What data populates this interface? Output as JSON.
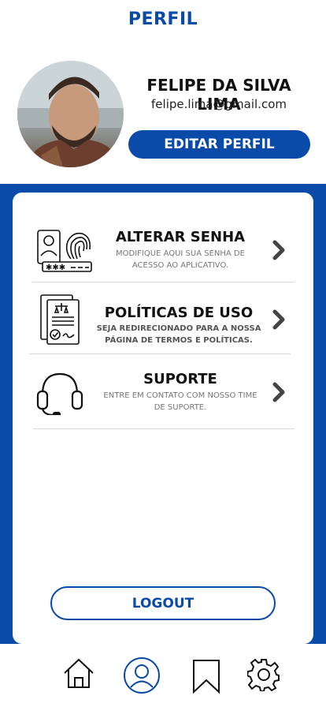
{
  "header": {
    "title": "PERFIL"
  },
  "profile": {
    "name": "FELIPE DA SILVA LIMA",
    "email": "felipe.lima@gmail.com",
    "edit_label": "EDITAR PERFIL"
  },
  "menu": [
    {
      "icon": "fingerprint-password-icon",
      "title": "ALTERAR SENHA",
      "desc1": "MODIFIQUE AQUI SUA SENHA DE",
      "desc2": "ACESSO AO APLICATIVO."
    },
    {
      "icon": "policy-document-icon",
      "title": "POLÍTICAS DE USO",
      "desc1": "SEJA REDIRECIONADO PARA A NOSSA",
      "desc2": "PÁGINA DE TERMOS E POLÍTICAS."
    },
    {
      "icon": "headset-icon",
      "title": "SUPORTE",
      "desc1": "ENTRE EM CONTATO COM NOSSO TIME",
      "desc2": "DE SUPORTE."
    }
  ],
  "logout_label": "LOGOUT",
  "tabs": [
    "home-icon",
    "profile-icon",
    "bookmark-icon",
    "settings-icon"
  ],
  "colors": {
    "primary": "#0a4aa8",
    "white": "#ffffff"
  }
}
